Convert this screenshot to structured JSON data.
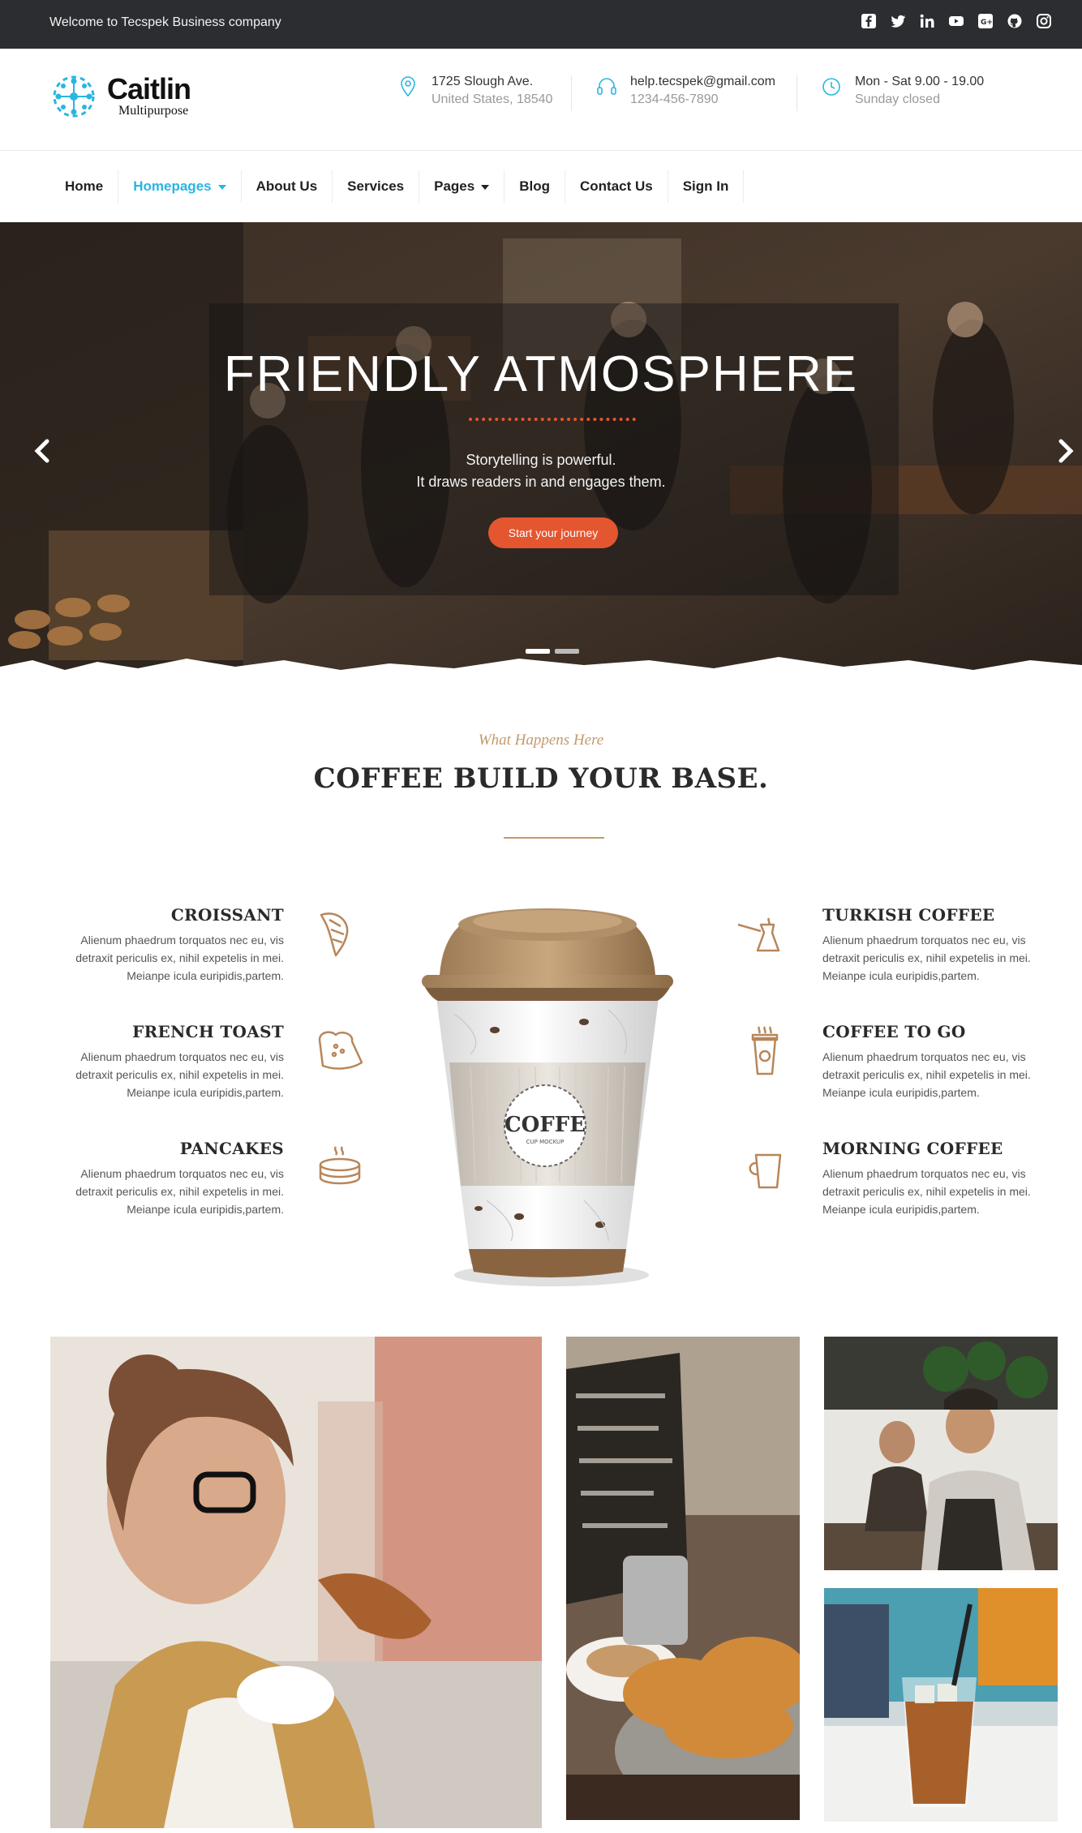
{
  "topbar": {
    "welcome": "Welcome to Tecspek Business company",
    "socials": [
      "facebook-icon",
      "twitter-icon",
      "linkedin-icon",
      "youtube-icon",
      "google-plus-icon",
      "github-icon",
      "instagram-icon"
    ]
  },
  "header": {
    "logo_name": "Caitlin",
    "logo_sub": "Multipurpose",
    "address": {
      "line1": "1725 Slough Ave.",
      "line2": "United States, 18540"
    },
    "contact": {
      "line1": "help.tecspek@gmail.com",
      "line2": "1234-456-7890"
    },
    "hours": {
      "line1": "Mon - Sat 9.00 - 19.00",
      "line2": "Sunday closed"
    }
  },
  "nav": {
    "items": [
      {
        "label": "Home"
      },
      {
        "label": "Homepages"
      },
      {
        "label": "About Us"
      },
      {
        "label": "Services"
      },
      {
        "label": "Pages"
      },
      {
        "label": "Blog"
      },
      {
        "label": "Contact Us"
      },
      {
        "label": "Sign In"
      }
    ]
  },
  "hero": {
    "title": "FRIENDLY ATMOSPHERE",
    "sub1": "Storytelling is powerful.",
    "sub2": "It draws readers in and engages them.",
    "button": "Start your journey"
  },
  "section": {
    "eyebrow": "What Happens Here",
    "title": "COFFEE BUILD YOUR BASE."
  },
  "features": {
    "left": [
      {
        "title": "CROISSANT",
        "text1": "Alienum phaedrum torquatos nec eu, vis",
        "text2": "detraxit periculis ex, nihil expetelis in mei.",
        "text3": "Meianpe icula euripidis,partem."
      },
      {
        "title": "FRENCH TOAST",
        "text1": "Alienum phaedrum torquatos nec eu, vis",
        "text2": "detraxit periculis ex, nihil expetelis in mei.",
        "text3": "Meianpe icula euripidis,partem."
      },
      {
        "title": "PANCAKES",
        "text1": "Alienum phaedrum torquatos nec eu, vis",
        "text2": "detraxit periculis ex, nihil expetelis in mei.",
        "text3": "Meianpe icula euripidis,partem."
      }
    ],
    "right": [
      {
        "title": "TURKISH COFFEE",
        "text1": "Alienum phaedrum torquatos nec eu, vis",
        "text2": "detraxit periculis ex, nihil expetelis in mei.",
        "text3": "Meianpe icula euripidis,partem."
      },
      {
        "title": "COFFEE TO GO",
        "text1": "Alienum phaedrum torquatos nec eu, vis",
        "text2": "detraxit periculis ex, nihil expetelis in mei.",
        "text3": "Meianpe icula euripidis,partem."
      },
      {
        "title": "MORNING COFFEE",
        "text1": "Alienum phaedrum torquatos nec eu, vis",
        "text2": "detraxit periculis ex, nihil expetelis in mei.",
        "text3": "Meianpe icula euripidis,partem."
      }
    ]
  },
  "cup": {
    "label": "COFFE",
    "sublabel": "CUP MOCKUP"
  },
  "colors": {
    "accent": "#29b6e0",
    "brown": "#c49a6c",
    "orange": "#e4562f",
    "dark": "#2b2d31"
  }
}
